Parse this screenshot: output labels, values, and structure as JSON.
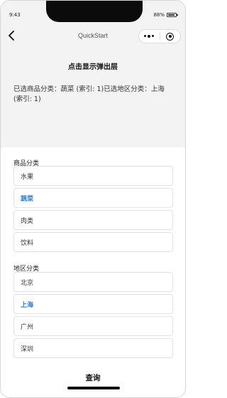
{
  "status_bar": {
    "time": "9:43",
    "battery": "88%"
  },
  "nav": {
    "title": "QuickStart"
  },
  "page": {
    "show_popup_label": "点击显示弹出层",
    "selection_summary": "已选商品分类：蔬菜 (索引: 1)已选地区分类：上海 (索引: 1)"
  },
  "popup": {
    "product_label": "商品分类",
    "products": [
      {
        "label": "水果",
        "selected": false
      },
      {
        "label": "蔬菜",
        "selected": true
      },
      {
        "label": "肉类",
        "selected": false
      },
      {
        "label": "饮料",
        "selected": false
      }
    ],
    "region_label": "地区分类",
    "regions": [
      {
        "label": "北京",
        "selected": false
      },
      {
        "label": "上海",
        "selected": true
      },
      {
        "label": "广州",
        "selected": false
      },
      {
        "label": "深圳",
        "selected": false
      }
    ],
    "query_label": "查询",
    "selected_color": "#2a7ee0"
  }
}
